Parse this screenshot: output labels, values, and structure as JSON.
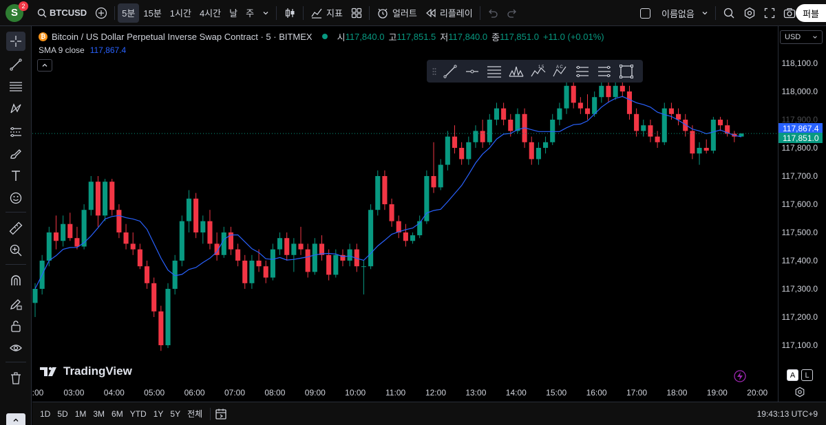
{
  "topbar": {
    "avatar_letter": "S",
    "notification_count": "2",
    "symbol": "BTCUSD",
    "intervals": [
      "5분",
      "15분",
      "1시간",
      "4시간",
      "날",
      "주"
    ],
    "active_interval": "5분",
    "indicators_label": "지표",
    "alert_label": "얼러트",
    "replay_label": "리플레이",
    "layout_name": "이름없음",
    "publish_label": "퍼블"
  },
  "legend": {
    "title": "Bitcoin / US Dollar Perpetual Inverse Swap Contract · 5 · BITMEX",
    "open_label": "시",
    "open": "117,840.0",
    "high_label": "고",
    "high": "117,851.5",
    "low_label": "저",
    "low": "117,840.0",
    "close_label": "종",
    "close": "117,851.0",
    "change": "+11.0 (+0.01%)",
    "sma_label": "SMA 9 close",
    "sma_value": "117,867.4"
  },
  "price_axis": {
    "currency": "USD",
    "ticks": [
      "118,100.0",
      "118,000.0",
      "117,900.0",
      "117,800.0",
      "117,700.0",
      "117,600.0",
      "117,500.0",
      "117,400.0",
      "117,300.0",
      "117,200.0",
      "117,100.0"
    ],
    "partial_tick": "117,900.0",
    "sma_tag": "117,867.4",
    "price_tag": "117,851.0"
  },
  "time_axis": {
    "ticks": [
      ":00",
      "03:00",
      "04:00",
      "05:00",
      "06:00",
      "07:00",
      "08:00",
      "09:00",
      "10:00",
      "11:00",
      "12:00",
      "13:00",
      "14:00",
      "15:00",
      "16:00",
      "17:00",
      "18:00",
      "19:00",
      "20:00"
    ]
  },
  "bottombar": {
    "ranges": [
      "1D",
      "5D",
      "1M",
      "3M",
      "6M",
      "YTD",
      "1Y",
      "5Y",
      "전체"
    ],
    "clock": "19:43:13 UTC+9"
  },
  "watermark": "TradingView",
  "scale_buttons": {
    "auto": "A",
    "log": "L"
  },
  "colors": {
    "up": "#089981",
    "down": "#f23645",
    "sma": "#2962ff",
    "background": "#000000"
  },
  "chart_data": {
    "type": "candlestick",
    "symbol": "BTCUSD",
    "interval": "5",
    "ylim": [
      117050,
      118150
    ],
    "overlay": "SMA 9 close",
    "series": [
      {
        "t": "02:55",
        "o": 117250,
        "h": 117320,
        "l": 117200,
        "c": 117300
      },
      {
        "t": "03:00",
        "o": 117300,
        "h": 117420,
        "l": 117280,
        "c": 117400
      },
      {
        "t": "03:10",
        "o": 117400,
        "h": 117520,
        "l": 117380,
        "c": 117500
      },
      {
        "t": "03:20",
        "o": 117500,
        "h": 117560,
        "l": 117440,
        "c": 117470
      },
      {
        "t": "03:30",
        "o": 117470,
        "h": 117560,
        "l": 117450,
        "c": 117530
      },
      {
        "t": "03:40",
        "o": 117530,
        "h": 117570,
        "l": 117470,
        "c": 117480
      },
      {
        "t": "03:50",
        "o": 117480,
        "h": 117520,
        "l": 117440,
        "c": 117450
      },
      {
        "t": "04:00",
        "o": 117450,
        "h": 117600,
        "l": 117440,
        "c": 117580
      },
      {
        "t": "04:10",
        "o": 117580,
        "h": 117700,
        "l": 117560,
        "c": 117680
      },
      {
        "t": "04:20",
        "o": 117680,
        "h": 117700,
        "l": 117520,
        "c": 117560
      },
      {
        "t": "04:30",
        "o": 117560,
        "h": 117690,
        "l": 117540,
        "c": 117680
      },
      {
        "t": "04:40",
        "o": 117680,
        "h": 117690,
        "l": 117560,
        "c": 117580
      },
      {
        "t": "04:50",
        "o": 117580,
        "h": 117600,
        "l": 117480,
        "c": 117500
      },
      {
        "t": "05:00",
        "o": 117500,
        "h": 117530,
        "l": 117440,
        "c": 117460
      },
      {
        "t": "05:10",
        "o": 117460,
        "h": 117500,
        "l": 117420,
        "c": 117440
      },
      {
        "t": "05:20",
        "o": 117440,
        "h": 117460,
        "l": 117370,
        "c": 117380
      },
      {
        "t": "05:30",
        "o": 117380,
        "h": 117400,
        "l": 117300,
        "c": 117320
      },
      {
        "t": "05:40",
        "o": 117320,
        "h": 117340,
        "l": 117200,
        "c": 117220
      },
      {
        "t": "05:50",
        "o": 117220,
        "h": 117240,
        "l": 117080,
        "c": 117100
      },
      {
        "t": "06:00",
        "o": 117100,
        "h": 117320,
        "l": 117090,
        "c": 117300
      },
      {
        "t": "06:10",
        "o": 117300,
        "h": 117420,
        "l": 117280,
        "c": 117400
      },
      {
        "t": "06:20",
        "o": 117400,
        "h": 117560,
        "l": 117380,
        "c": 117540
      },
      {
        "t": "06:30",
        "o": 117540,
        "h": 117650,
        "l": 117500,
        "c": 117620
      },
      {
        "t": "06:40",
        "o": 117620,
        "h": 117640,
        "l": 117480,
        "c": 117500
      },
      {
        "t": "06:50",
        "o": 117500,
        "h": 117560,
        "l": 117460,
        "c": 117540
      },
      {
        "t": "07:00",
        "o": 117540,
        "h": 117580,
        "l": 117440,
        "c": 117460
      },
      {
        "t": "07:10",
        "o": 117460,
        "h": 117500,
        "l": 117400,
        "c": 117420
      },
      {
        "t": "07:20",
        "o": 117420,
        "h": 117520,
        "l": 117410,
        "c": 117500
      },
      {
        "t": "07:30",
        "o": 117500,
        "h": 117520,
        "l": 117420,
        "c": 117440
      },
      {
        "t": "07:40",
        "o": 117440,
        "h": 117460,
        "l": 117380,
        "c": 117400
      },
      {
        "t": "07:50",
        "o": 117400,
        "h": 117420,
        "l": 117300,
        "c": 117320
      },
      {
        "t": "08:00",
        "o": 117320,
        "h": 117420,
        "l": 117300,
        "c": 117400
      },
      {
        "t": "08:10",
        "o": 117400,
        "h": 117440,
        "l": 117360,
        "c": 117380
      },
      {
        "t": "08:20",
        "o": 117380,
        "h": 117400,
        "l": 117320,
        "c": 117340
      },
      {
        "t": "08:30",
        "o": 117340,
        "h": 117460,
        "l": 117330,
        "c": 117440
      },
      {
        "t": "08:40",
        "o": 117440,
        "h": 117500,
        "l": 117420,
        "c": 117480
      },
      {
        "t": "08:50",
        "o": 117480,
        "h": 117500,
        "l": 117400,
        "c": 117420
      },
      {
        "t": "09:00",
        "o": 117420,
        "h": 117480,
        "l": 117360,
        "c": 117460
      },
      {
        "t": "09:10",
        "o": 117460,
        "h": 117520,
        "l": 117420,
        "c": 117440
      },
      {
        "t": "09:20",
        "o": 117440,
        "h": 117460,
        "l": 117340,
        "c": 117360
      },
      {
        "t": "09:30",
        "o": 117360,
        "h": 117480,
        "l": 117350,
        "c": 117460
      },
      {
        "t": "09:40",
        "o": 117460,
        "h": 117490,
        "l": 117400,
        "c": 117420
      },
      {
        "t": "09:50",
        "o": 117420,
        "h": 117440,
        "l": 117330,
        "c": 117350
      },
      {
        "t": "10:00",
        "o": 117350,
        "h": 117440,
        "l": 117340,
        "c": 117420
      },
      {
        "t": "10:10",
        "o": 117420,
        "h": 117440,
        "l": 117380,
        "c": 117400
      },
      {
        "t": "10:20",
        "o": 117400,
        "h": 117460,
        "l": 117380,
        "c": 117440
      },
      {
        "t": "10:30",
        "o": 117440,
        "h": 117460,
        "l": 117360,
        "c": 117380
      },
      {
        "t": "10:40",
        "o": 117380,
        "h": 117400,
        "l": 117280,
        "c": 117380
      },
      {
        "t": "10:50",
        "o": 117380,
        "h": 117600,
        "l": 117370,
        "c": 117580
      },
      {
        "t": "11:00",
        "o": 117580,
        "h": 117720,
        "l": 117560,
        "c": 117700
      },
      {
        "t": "11:10",
        "o": 117700,
        "h": 117720,
        "l": 117580,
        "c": 117600
      },
      {
        "t": "11:20",
        "o": 117600,
        "h": 117620,
        "l": 117520,
        "c": 117540
      },
      {
        "t": "11:30",
        "o": 117540,
        "h": 117560,
        "l": 117480,
        "c": 117500
      },
      {
        "t": "11:40",
        "o": 117500,
        "h": 117530,
        "l": 117450,
        "c": 117470
      },
      {
        "t": "11:50",
        "o": 117470,
        "h": 117500,
        "l": 117460,
        "c": 117490
      },
      {
        "t": "12:00",
        "o": 117490,
        "h": 117560,
        "l": 117480,
        "c": 117540
      },
      {
        "t": "12:10",
        "o": 117540,
        "h": 117720,
        "l": 117530,
        "c": 117700
      },
      {
        "t": "12:20",
        "o": 117700,
        "h": 117820,
        "l": 117640,
        "c": 117660
      },
      {
        "t": "12:30",
        "o": 117660,
        "h": 117760,
        "l": 117650,
        "c": 117740
      },
      {
        "t": "12:40",
        "o": 117740,
        "h": 117860,
        "l": 117720,
        "c": 117840
      },
      {
        "t": "12:50",
        "o": 117840,
        "h": 117880,
        "l": 117780,
        "c": 117800
      },
      {
        "t": "13:00",
        "o": 117800,
        "h": 117820,
        "l": 117740,
        "c": 117760
      },
      {
        "t": "13:10",
        "o": 117760,
        "h": 117840,
        "l": 117740,
        "c": 117820
      },
      {
        "t": "13:20",
        "o": 117820,
        "h": 117880,
        "l": 117800,
        "c": 117860
      },
      {
        "t": "13:30",
        "o": 117860,
        "h": 117900,
        "l": 117800,
        "c": 117820
      },
      {
        "t": "13:40",
        "o": 117820,
        "h": 117920,
        "l": 117810,
        "c": 117900
      },
      {
        "t": "13:50",
        "o": 117900,
        "h": 117960,
        "l": 117880,
        "c": 117940
      },
      {
        "t": "14:00",
        "o": 117940,
        "h": 117960,
        "l": 117880,
        "c": 117900
      },
      {
        "t": "14:10",
        "o": 117900,
        "h": 117920,
        "l": 117840,
        "c": 117860
      },
      {
        "t": "14:20",
        "o": 117860,
        "h": 117940,
        "l": 117850,
        "c": 117920
      },
      {
        "t": "14:30",
        "o": 117920,
        "h": 117940,
        "l": 117800,
        "c": 117820
      },
      {
        "t": "14:40",
        "o": 117820,
        "h": 117840,
        "l": 117740,
        "c": 117760
      },
      {
        "t": "14:50",
        "o": 117760,
        "h": 117820,
        "l": 117740,
        "c": 117800
      },
      {
        "t": "15:00",
        "o": 117800,
        "h": 117840,
        "l": 117780,
        "c": 117820
      },
      {
        "t": "15:10",
        "o": 117820,
        "h": 117920,
        "l": 117810,
        "c": 117900
      },
      {
        "t": "15:20",
        "o": 117900,
        "h": 117960,
        "l": 117880,
        "c": 117940
      },
      {
        "t": "15:30",
        "o": 117940,
        "h": 118060,
        "l": 117920,
        "c": 118020
      },
      {
        "t": "15:40",
        "o": 118020,
        "h": 118040,
        "l": 117940,
        "c": 117960
      },
      {
        "t": "15:50",
        "o": 117960,
        "h": 117980,
        "l": 117920,
        "c": 117940
      },
      {
        "t": "16:00",
        "o": 117940,
        "h": 117990,
        "l": 117900,
        "c": 117920
      },
      {
        "t": "16:10",
        "o": 117920,
        "h": 118000,
        "l": 117910,
        "c": 117980
      },
      {
        "t": "16:20",
        "o": 117980,
        "h": 118040,
        "l": 117960,
        "c": 118020
      },
      {
        "t": "16:30",
        "o": 118020,
        "h": 118040,
        "l": 117960,
        "c": 117980
      },
      {
        "t": "16:40",
        "o": 117980,
        "h": 118040,
        "l": 117970,
        "c": 118020
      },
      {
        "t": "16:50",
        "o": 118020,
        "h": 118060,
        "l": 117980,
        "c": 118000
      },
      {
        "t": "17:00",
        "o": 118000,
        "h": 118020,
        "l": 117900,
        "c": 117920
      },
      {
        "t": "17:10",
        "o": 117920,
        "h": 117940,
        "l": 117840,
        "c": 117860
      },
      {
        "t": "17:20",
        "o": 117860,
        "h": 117900,
        "l": 117840,
        "c": 117880
      },
      {
        "t": "17:30",
        "o": 117880,
        "h": 117900,
        "l": 117820,
        "c": 117840
      },
      {
        "t": "17:40",
        "o": 117840,
        "h": 117860,
        "l": 117800,
        "c": 117820
      },
      {
        "t": "17:50",
        "o": 117820,
        "h": 117960,
        "l": 117810,
        "c": 117940
      },
      {
        "t": "18:00",
        "o": 117940,
        "h": 117960,
        "l": 117900,
        "c": 117920
      },
      {
        "t": "18:10",
        "o": 117920,
        "h": 117940,
        "l": 117880,
        "c": 117900
      },
      {
        "t": "18:20",
        "o": 117900,
        "h": 117920,
        "l": 117840,
        "c": 117860
      },
      {
        "t": "18:30",
        "o": 117860,
        "h": 117880,
        "l": 117760,
        "c": 117780
      },
      {
        "t": "18:40",
        "o": 117780,
        "h": 117820,
        "l": 117740,
        "c": 117800
      },
      {
        "t": "18:50",
        "o": 117800,
        "h": 117830,
        "l": 117780,
        "c": 117790
      },
      {
        "t": "19:00",
        "o": 117790,
        "h": 117910,
        "l": 117780,
        "c": 117900
      },
      {
        "t": "19:10",
        "o": 117900,
        "h": 117910,
        "l": 117860,
        "c": 117880
      },
      {
        "t": "19:20",
        "o": 117880,
        "h": 117900,
        "l": 117840,
        "c": 117850
      },
      {
        "t": "19:30",
        "o": 117850,
        "h": 117860,
        "l": 117820,
        "c": 117840
      },
      {
        "t": "19:40",
        "o": 117840,
        "h": 117851.5,
        "l": 117840,
        "c": 117851
      }
    ]
  }
}
